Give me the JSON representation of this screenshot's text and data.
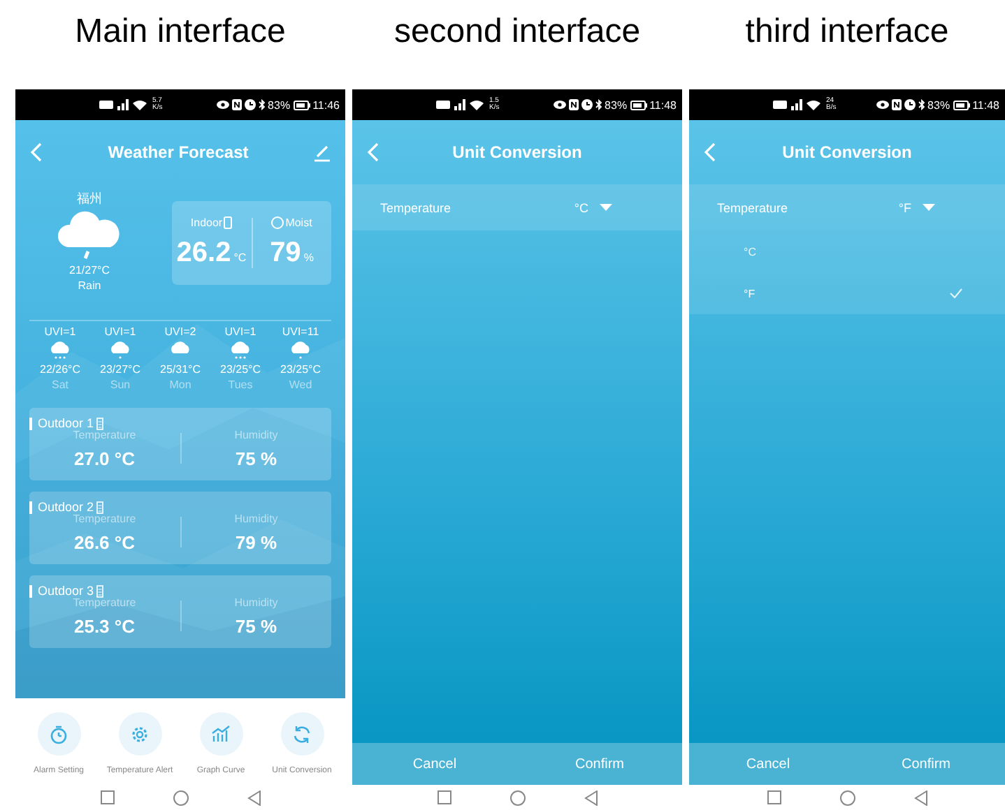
{
  "captions": [
    "Main interface",
    "second interface",
    "third interface"
  ],
  "phones": [
    {
      "kind": "main",
      "status": {
        "speed": "5.7",
        "speed_unit": "K/s",
        "battery": "83%",
        "time": "11:46"
      },
      "title": "Weather Forecast",
      "city": "福州",
      "temp_range": "21/27°C",
      "condition": "Rain",
      "indoor": {
        "label": "Indoor",
        "value": "26.2",
        "unit": "°C"
      },
      "moist": {
        "label": "Moist",
        "value": "79",
        "unit": "%"
      },
      "forecast": [
        {
          "uvi": "UVI=1",
          "kind": "showers",
          "temp": "22/26°C",
          "day": "Sat"
        },
        {
          "uvi": "UVI=1",
          "kind": "drizzle",
          "temp": "23/27°C",
          "day": "Sun"
        },
        {
          "uvi": "UVI=2",
          "kind": "cloudy",
          "temp": "25/31°C",
          "day": "Mon"
        },
        {
          "uvi": "UVI=1",
          "kind": "showers",
          "temp": "23/25°C",
          "day": "Tues"
        },
        {
          "uvi": "UVI=11",
          "kind": "drizzle",
          "temp": "23/25°C",
          "day": "Wed"
        }
      ],
      "outdoor": [
        {
          "name": "Outdoor 1",
          "temp_label": "Temperature",
          "temp": "27.0 °C",
          "hum_label": "Humidity",
          "hum": "75 %"
        },
        {
          "name": "Outdoor 2",
          "temp_label": "Temperature",
          "temp": "26.6 °C",
          "hum_label": "Humidity",
          "hum": "79 %"
        },
        {
          "name": "Outdoor 3",
          "temp_label": "Temperature",
          "temp": "25.3 °C",
          "hum_label": "Humidity",
          "hum": "75 %"
        }
      ],
      "actions": [
        {
          "kind": "timer",
          "label": "Alarm Setting"
        },
        {
          "kind": "gear",
          "label": "Temperature Alert"
        },
        {
          "kind": "chart",
          "label": "Graph Curve"
        },
        {
          "kind": "refresh",
          "label": "Unit Conversion"
        }
      ]
    },
    {
      "kind": "unit",
      "status": {
        "speed": "1.5",
        "speed_unit": "K/s",
        "battery": "83%",
        "time": "11:48"
      },
      "title": "Unit Conversion",
      "setting": {
        "label": "Temperature",
        "value": "°C"
      },
      "buttons": [
        "Cancel",
        "Confirm"
      ]
    },
    {
      "kind": "unit",
      "status": {
        "speed": "24",
        "speed_unit": "B/s",
        "battery": "83%",
        "time": "11:48"
      },
      "title": "Unit Conversion",
      "setting": {
        "label": "Temperature",
        "value": "°F"
      },
      "options": [
        {
          "label": "°C",
          "selected": false
        },
        {
          "label": "°F",
          "selected": true
        }
      ],
      "buttons": [
        "Cancel",
        "Confirm"
      ]
    }
  ]
}
